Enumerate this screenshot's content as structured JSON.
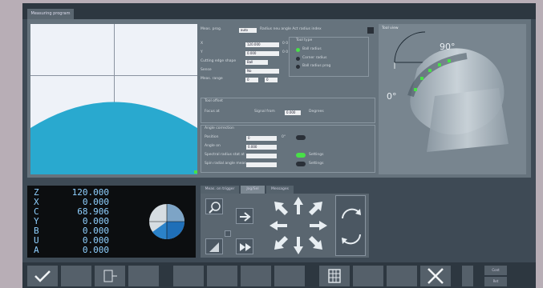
{
  "tab": {
    "label": "Measuring program"
  },
  "params": {
    "mode_label": "Meas. prog.",
    "mode_value": "auto",
    "mode_suffix": "Radius neu angle  Act radius index",
    "r1_label": "X",
    "r1_value": "120.000",
    "r1_unit": "0 0",
    "r2_label": "Y",
    "r2_value": "0.000",
    "r2_unit": "0 0",
    "cutting_label": "Cutting edge shape",
    "cutting_value": "Ball",
    "sense_label": "Sense",
    "sense_value": "No",
    "angle_label": "Meas. range",
    "angle_v1": "0",
    "angle_v2": "0",
    "tool_type_title": "Tool type",
    "tool_type_opts": [
      "Ball radius",
      "Corner radius",
      "Ball radius prog"
    ],
    "sec2_title": "Tool offset",
    "focus_label": "Focus at",
    "signal_label": "Signal from",
    "signal_value": "0.000",
    "degrees_label": "Degrees",
    "sec3_title": "Angle correction",
    "position_label": "Position",
    "position_value": "0",
    "position_after": "0°",
    "angle_on_label": "Angle on",
    "angle_on_value": "0.000",
    "spec_label": "Spectral radius stat at",
    "spec_check": "Settings",
    "spin_label": "Spin radial angle meas.",
    "spin_check": "Settings"
  },
  "tool_view": {
    "title": "Tool view",
    "angle_top": "90°",
    "angle_left": "0°"
  },
  "dro": {
    "axes": [
      {
        "axis": "Z",
        "value": "120.000"
      },
      {
        "axis": "X",
        "value": "0.000"
      },
      {
        "axis": "C",
        "value": "68.906"
      },
      {
        "axis": "Y",
        "value": "0.000"
      },
      {
        "axis": "B",
        "value": "0.000"
      },
      {
        "axis": "U",
        "value": "0.000"
      },
      {
        "axis": "A",
        "value": "0.000"
      }
    ]
  },
  "mid_tabs": [
    "Meas. on trigger",
    "Jog/Sel",
    "Messages"
  ],
  "softkeys": {
    "right_top": "Cont",
    "right_bottom": "Ret"
  },
  "colors": {
    "accent": "#29a9cf",
    "active": "#48e048",
    "panel": "#66737d"
  }
}
